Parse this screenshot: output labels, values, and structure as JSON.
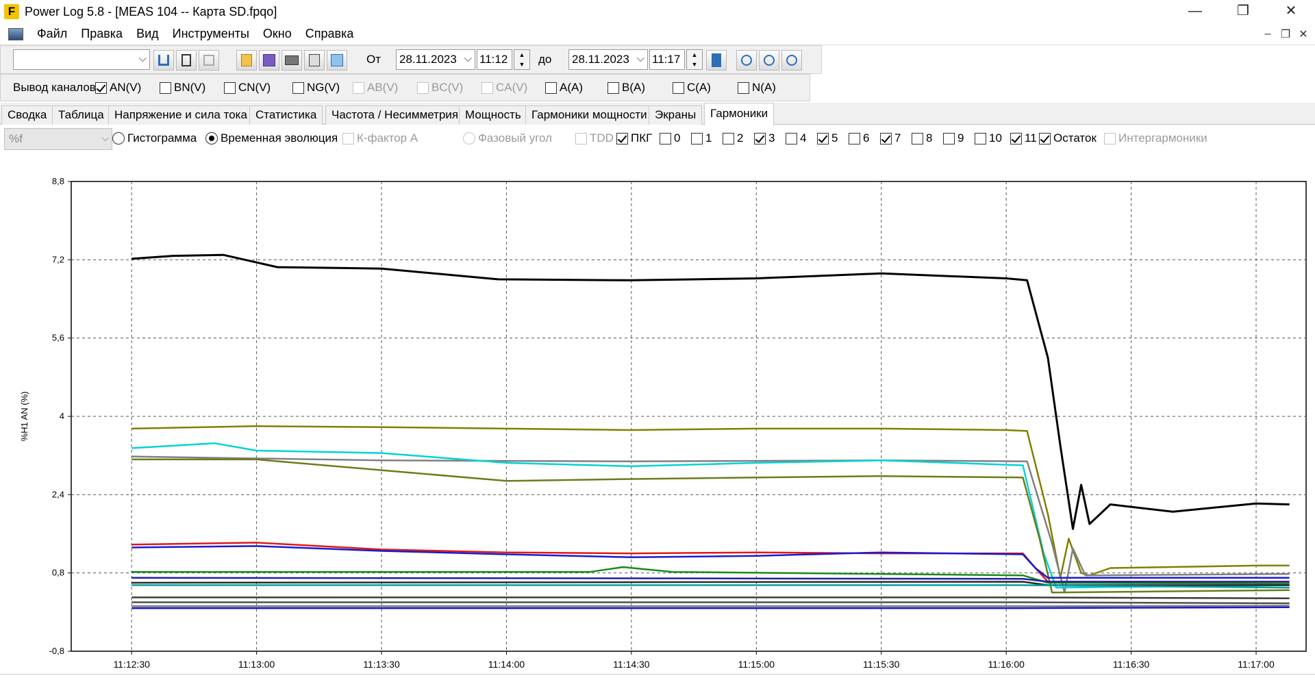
{
  "window": {
    "title": "Power Log 5.8 - [MEAS 104 -- Карта SD.fpqo]",
    "logo_letter": "F",
    "controls": [
      "—",
      "❐",
      "✕"
    ],
    "mdi_controls": [
      "–",
      "❐",
      "✕"
    ]
  },
  "menu": [
    "Файл",
    "Правка",
    "Вид",
    "Инструменты",
    "Окно",
    "Справка"
  ],
  "toolbar": {
    "combo_value": "",
    "from_label": "От",
    "from_date": "28.11.2023",
    "from_time": "11:12",
    "to_label": "до",
    "to_date": "28.11.2023",
    "to_time": "11:17"
  },
  "channels": {
    "label": "Вывод каналов",
    "items": [
      {
        "label": "AN(V)",
        "checked": true,
        "enabled": true
      },
      {
        "label": "BN(V)",
        "checked": false,
        "enabled": true
      },
      {
        "label": "CN(V)",
        "checked": false,
        "enabled": true
      },
      {
        "label": "NG(V)",
        "checked": false,
        "enabled": true
      },
      {
        "label": "AB(V)",
        "checked": false,
        "enabled": false
      },
      {
        "label": "BC(V)",
        "checked": false,
        "enabled": false
      },
      {
        "label": "CA(V)",
        "checked": false,
        "enabled": false
      },
      {
        "label": "A(A)",
        "checked": false,
        "enabled": true
      },
      {
        "label": "B(A)",
        "checked": false,
        "enabled": true
      },
      {
        "label": "C(A)",
        "checked": false,
        "enabled": true
      },
      {
        "label": "N(A)",
        "checked": false,
        "enabled": true
      }
    ]
  },
  "tabs": [
    "Сводка",
    "Таблица",
    "Напряжение и сила тока",
    "Статистика",
    "Частота / Несимметрия",
    "Мощность",
    "Гармоники мощности",
    "Экраны",
    "Гармоники"
  ],
  "active_tab": "Гармоники",
  "options": {
    "unit_combo": "%f",
    "radio_histogram": "Гистограмма",
    "radio_time": "Временная эволюция",
    "kfactor": "К-фактор А",
    "phase_angle": "Фазовый угол",
    "harmonics": [
      {
        "label": "TDD",
        "checked": false,
        "enabled": false
      },
      {
        "label": "ПКГ",
        "checked": true,
        "enabled": true
      },
      {
        "label": "0",
        "checked": false,
        "enabled": true
      },
      {
        "label": "1",
        "checked": false,
        "enabled": true
      },
      {
        "label": "2",
        "checked": false,
        "enabled": true
      },
      {
        "label": "3",
        "checked": true,
        "enabled": true
      },
      {
        "label": "4",
        "checked": false,
        "enabled": true
      },
      {
        "label": "5",
        "checked": true,
        "enabled": true
      },
      {
        "label": "6",
        "checked": false,
        "enabled": true
      },
      {
        "label": "7",
        "checked": true,
        "enabled": true
      },
      {
        "label": "8",
        "checked": false,
        "enabled": true
      },
      {
        "label": "9",
        "checked": false,
        "enabled": true
      },
      {
        "label": "10",
        "checked": false,
        "enabled": true
      },
      {
        "label": "11",
        "checked": true,
        "enabled": true
      },
      {
        "label": "Остаток",
        "checked": true,
        "enabled": true
      },
      {
        "label": "Интергармоники",
        "checked": false,
        "enabled": false
      }
    ]
  },
  "chart_data": {
    "type": "line",
    "ylabel": "%H1 AN (%)",
    "ylim": [
      -0.8,
      8.8
    ],
    "yticks": [
      "8,8",
      "7,2",
      "5,6",
      "4",
      "2,4",
      "0,8",
      "-0,8"
    ],
    "xticks": [
      "11:12:30",
      "11:13:00",
      "11:13:30",
      "11:14:00",
      "11:14:30",
      "11:15:00",
      "11:15:30",
      "11:16:00",
      "11:16:30",
      "11:17:00"
    ],
    "grid": true,
    "series": [
      {
        "color": "#000000",
        "x": [
          "11:12:30",
          "11:12:40",
          "11:12:52",
          "11:13:05",
          "11:13:30",
          "11:13:58",
          "11:14:30",
          "11:15:00",
          "11:15:30",
          "11:16:00",
          "11:16:05",
          "11:16:10",
          "11:16:13",
          "11:16:16",
          "11:16:18",
          "11:16:20",
          "11:16:25",
          "11:16:40",
          "11:17:00",
          "11:17:08"
        ],
        "y": [
          7.22,
          7.28,
          7.3,
          7.05,
          7.02,
          6.8,
          6.78,
          6.82,
          6.92,
          6.82,
          6.78,
          5.2,
          3.4,
          1.7,
          2.6,
          1.8,
          2.2,
          2.05,
          2.22,
          2.2
        ]
      },
      {
        "color": "#808000",
        "x": [
          "11:12:30",
          "11:13:00",
          "11:13:30",
          "11:14:00",
          "11:14:30",
          "11:15:00",
          "11:15:30",
          "11:16:00",
          "11:16:05",
          "11:16:10",
          "11:16:13",
          "11:16:15",
          "11:16:18",
          "11:16:20",
          "11:16:25",
          "11:17:00",
          "11:17:08"
        ],
        "y": [
          3.75,
          3.8,
          3.78,
          3.75,
          3.72,
          3.75,
          3.75,
          3.72,
          3.7,
          2.0,
          0.7,
          1.5,
          0.8,
          0.75,
          0.9,
          0.95,
          0.95
        ]
      },
      {
        "color": "#808080",
        "x": [
          "11:12:30",
          "11:13:30",
          "11:14:30",
          "11:15:30",
          "11:16:05",
          "11:16:11",
          "11:16:14",
          "11:16:16",
          "11:16:19",
          "11:17:08"
        ],
        "y": [
          3.18,
          3.1,
          3.08,
          3.1,
          3.08,
          1.4,
          0.4,
          1.3,
          0.75,
          0.78
        ]
      },
      {
        "color": "#00d4d4",
        "x": [
          "11:12:30",
          "11:12:50",
          "11:13:00",
          "11:13:30",
          "11:14:00",
          "11:14:30",
          "11:15:00",
          "11:15:30",
          "11:16:04",
          "11:16:09",
          "11:16:12",
          "11:17:08"
        ],
        "y": [
          3.35,
          3.45,
          3.3,
          3.25,
          3.05,
          2.98,
          3.05,
          3.1,
          3.0,
          1.2,
          0.5,
          0.55
        ]
      },
      {
        "color": "#6b7c1a",
        "x": [
          "11:12:30",
          "11:13:00",
          "11:13:30",
          "11:14:00",
          "11:14:30",
          "11:15:00",
          "11:15:30",
          "11:16:04",
          "11:16:08",
          "11:16:11",
          "11:17:08"
        ],
        "y": [
          3.12,
          3.12,
          2.9,
          2.68,
          2.72,
          2.75,
          2.78,
          2.75,
          1.5,
          0.4,
          0.45
        ]
      },
      {
        "color": "#e01818",
        "x": [
          "11:12:30",
          "11:13:00",
          "11:13:30",
          "11:14:00",
          "11:14:30",
          "11:15:00",
          "11:15:30",
          "11:16:04",
          "11:16:07",
          "11:16:10",
          "11:17:08"
        ],
        "y": [
          1.38,
          1.42,
          1.28,
          1.22,
          1.2,
          1.22,
          1.2,
          1.2,
          0.9,
          0.62,
          0.62
        ]
      },
      {
        "color": "#1a1ad4",
        "x": [
          "11:12:30",
          "11:13:00",
          "11:13:30",
          "11:14:00",
          "11:14:30",
          "11:15:00",
          "11:15:30",
          "11:16:04",
          "11:16:07",
          "11:16:10",
          "11:17:08"
        ],
        "y": [
          1.32,
          1.35,
          1.25,
          1.18,
          1.12,
          1.15,
          1.22,
          1.18,
          0.9,
          0.7,
          0.7
        ]
      },
      {
        "color": "#1a8a1a",
        "x": [
          "11:12:30",
          "11:14:20",
          "11:14:28",
          "11:14:40",
          "11:16:04",
          "11:16:10",
          "11:17:08"
        ],
        "y": [
          0.82,
          0.82,
          0.92,
          0.82,
          0.75,
          0.6,
          0.58
        ]
      },
      {
        "color": "#2020a0",
        "x": [
          "11:12:30",
          "11:16:04",
          "11:16:10",
          "11:17:08"
        ],
        "y": [
          0.7,
          0.68,
          0.62,
          0.62
        ]
      },
      {
        "color": "#2a2a2a",
        "x": [
          "11:12:30",
          "11:16:04",
          "11:16:10",
          "11:17:08"
        ],
        "y": [
          0.6,
          0.62,
          0.55,
          0.55
        ]
      },
      {
        "color": "#00a0a0",
        "x": [
          "11:12:30",
          "11:16:04",
          "11:17:08"
        ],
        "y": [
          0.55,
          0.55,
          0.5
        ]
      },
      {
        "color": "#3c3c3c",
        "x": [
          "11:12:30",
          "11:16:04",
          "11:17:08"
        ],
        "y": [
          0.3,
          0.3,
          0.28
        ]
      },
      {
        "color": "#505050",
        "x": [
          "11:12:30",
          "11:16:04",
          "11:17:08"
        ],
        "y": [
          0.2,
          0.2,
          0.18
        ]
      },
      {
        "color": "#1a1ad4",
        "x": [
          "11:12:30",
          "11:16:04",
          "11:17:08"
        ],
        "y": [
          0.08,
          0.08,
          0.1
        ]
      },
      {
        "color": "#7a7a7a",
        "x": [
          "11:12:30",
          "11:16:04",
          "11:17:08"
        ],
        "y": [
          0.12,
          0.12,
          0.13
        ]
      }
    ]
  }
}
